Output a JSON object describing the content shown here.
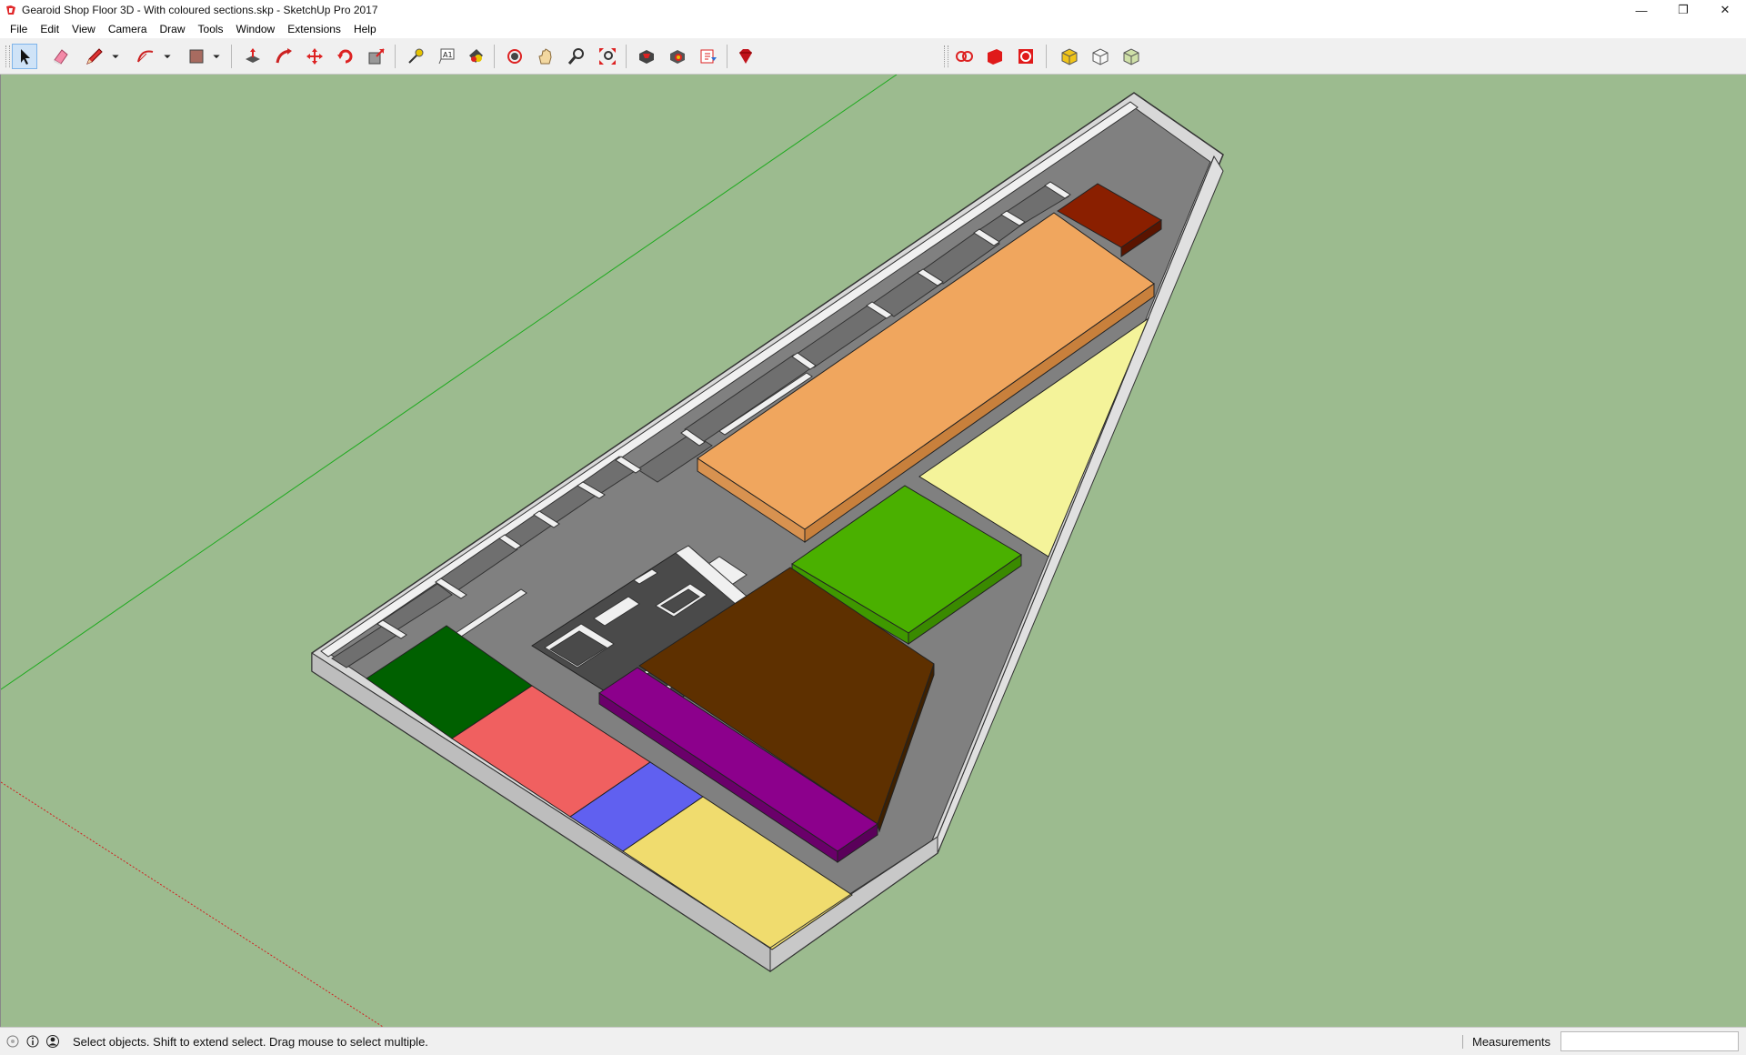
{
  "window": {
    "title": "Gearoid Shop Floor 3D - With coloured sections.skp - SketchUp Pro 2017",
    "minimize_glyph": "—",
    "restore_glyph": "❐",
    "close_glyph": "✕"
  },
  "menu": {
    "items": [
      "File",
      "Edit",
      "View",
      "Camera",
      "Draw",
      "Tools",
      "Window",
      "Extensions",
      "Help"
    ]
  },
  "toolbar": {
    "tools": [
      {
        "icon": "select-arrow-icon"
      },
      {
        "icon": "eraser-icon"
      },
      {
        "icon": "pencil-line-icon"
      },
      {
        "icon": "arc-icon"
      },
      {
        "icon": "rectangle-shape-icon"
      },
      {
        "icon": "push-pull-icon"
      },
      {
        "icon": "follow-me-icon"
      },
      {
        "icon": "move-icon"
      },
      {
        "icon": "rotate-icon"
      },
      {
        "icon": "scale-icon"
      },
      {
        "icon": "tape-measure-icon"
      },
      {
        "icon": "text-icon"
      },
      {
        "icon": "paint-bucket-icon"
      },
      {
        "icon": "orbit-icon"
      },
      {
        "icon": "pan-hand-icon"
      },
      {
        "icon": "zoom-icon"
      },
      {
        "icon": "zoom-extents-icon"
      },
      {
        "icon": "3d-warehouse-icon"
      },
      {
        "icon": "extension-warehouse-icon"
      },
      {
        "icon": "layout-send-icon"
      },
      {
        "icon": "extension-manager-icon"
      },
      {
        "icon": "section-plane-icon"
      },
      {
        "icon": "section-fill-icon"
      },
      {
        "icon": "section-display-icon"
      },
      {
        "icon": "component-yellow-icon"
      },
      {
        "icon": "component-white-icon"
      },
      {
        "icon": "component-green-icon"
      }
    ]
  },
  "status": {
    "text": "Select objects. Shift to extend select. Drag mouse to select multiple.",
    "measurements_label": "Measurements",
    "measurements_value": ""
  },
  "colors": {
    "sky": "#9cbb8f",
    "floor": "#7f7f7f",
    "offices_floor": "#4a4a4a",
    "wall_top": "#f2f2f2",
    "orange_block": "#f0a65e",
    "dark_red_block": "#8a1f00",
    "pale_yellow": "#f4f39a",
    "light_green": "#4ab000",
    "dark_brown": "#5e3000",
    "purple": "#8c008c",
    "dark_green": "#006000",
    "salmon": "#f06060",
    "blue": "#6060f0",
    "yellow": "#f0dc6e"
  }
}
